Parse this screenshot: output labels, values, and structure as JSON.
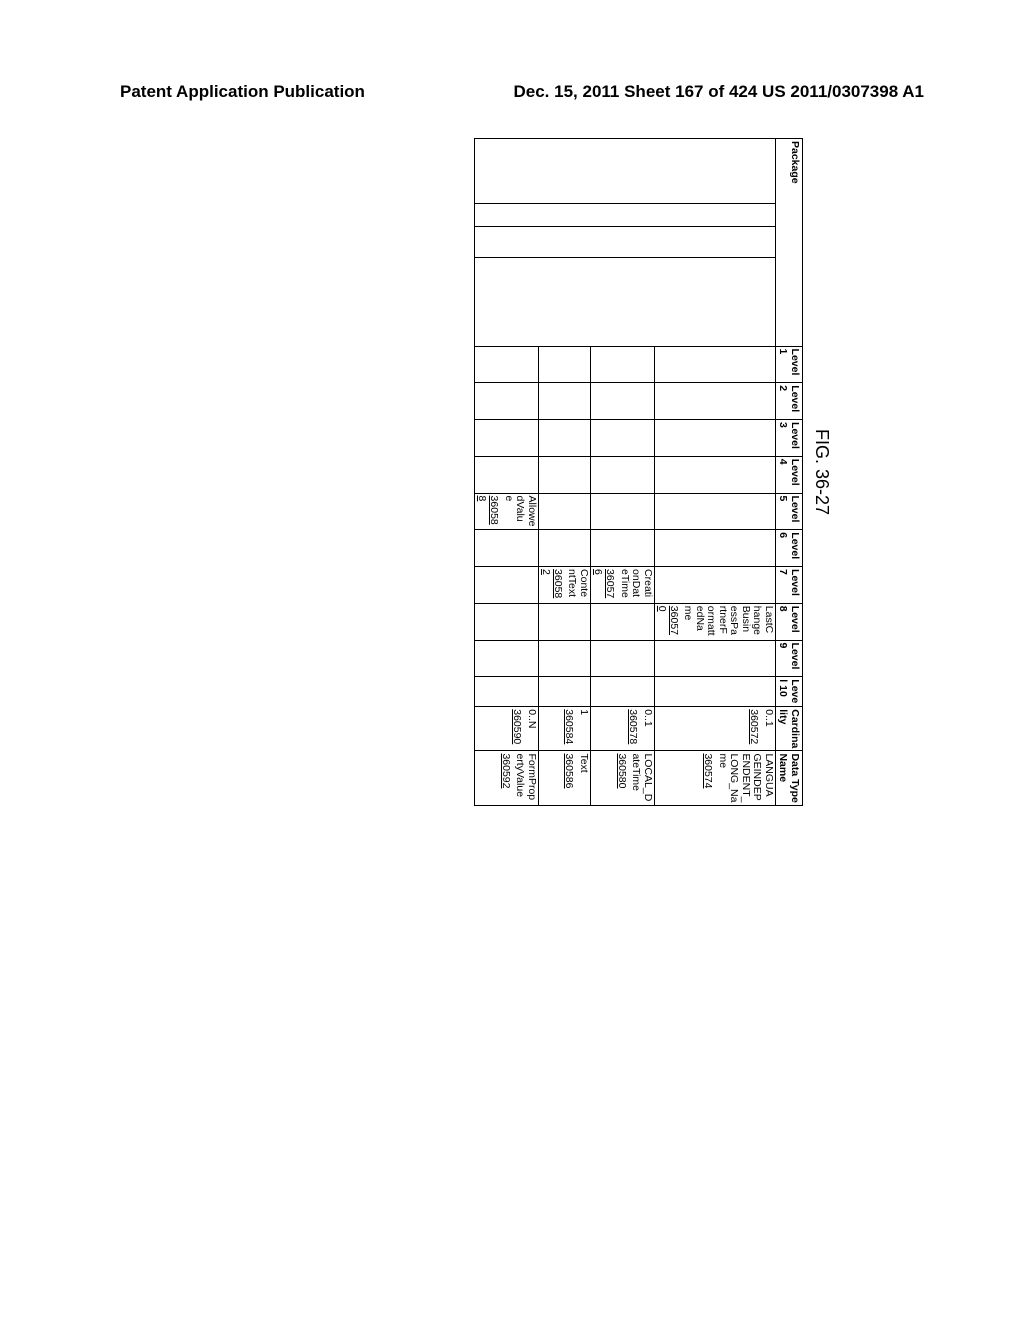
{
  "header": {
    "left": "Patent Application Publication",
    "right": "Dec. 15, 2011  Sheet 167 of 424   US 2011/0307398 A1"
  },
  "figure_label": "FIG. 36-27",
  "columns": [
    "Package",
    "",
    "",
    "",
    "Level 1",
    "Level 2",
    "Level 3",
    "Level 4",
    "Level 5",
    "Level 6",
    "Level 7",
    "Level 8",
    "Level 9",
    "Level 10",
    "Cardinality",
    "Data Type Name"
  ],
  "rows": [
    {
      "l8": {
        "text": "LastChangeBusinessPartnerFormattedName",
        "ref": "360570"
      },
      "card": {
        "text": "0..1",
        "ref": "360572"
      },
      "dt": {
        "text": "LANGUAGEINDEPENDENT_LONG_Name",
        "ref": "360574"
      }
    },
    {
      "l7": {
        "text": "CreationDateTime",
        "ref": "360576"
      },
      "card": {
        "text": "0..1",
        "ref": "360578"
      },
      "dt": {
        "text": "LOCAL_DateTime",
        "ref": "360580"
      }
    },
    {
      "l7": {
        "text": "ContentText",
        "ref": "360582"
      },
      "card": {
        "text": "1",
        "ref": "360584"
      },
      "dt": {
        "text": "Text",
        "ref": "360586"
      }
    },
    {
      "l5": {
        "text": "AllowedValue",
        "ref": "360588"
      },
      "card": {
        "text": "0..N",
        "ref": "360590"
      },
      "dt": {
        "text": "FormPropertyValue",
        "ref": "360592"
      }
    }
  ]
}
